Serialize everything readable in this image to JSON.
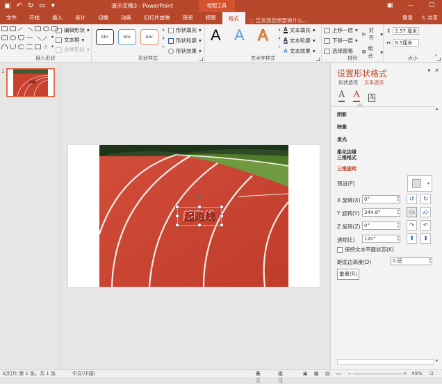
{
  "app": {
    "doc_title": "演示文稿3 - PowerPoint",
    "context_tool": "绘图工具",
    "accent": "#b7472a"
  },
  "quick_access": {
    "save_icon": "save-icon",
    "undo_icon": "undo-icon",
    "redo_icon": "redo-icon",
    "present_icon": "present-icon"
  },
  "tabs": [
    "文件",
    "开始",
    "插入",
    "设计",
    "切换",
    "动画",
    "幻灯片放映",
    "审阅",
    "视图",
    "格式"
  ],
  "active_tab": "格式",
  "tellme": "告诉我您想要做什么...",
  "login": "登录",
  "share": "共享",
  "ribbon": {
    "insert_shapes": {
      "label": "插入形状",
      "edit_shape": "编辑形状",
      "textbox": "文本框",
      "merge_shapes": "合并形状"
    },
    "shape_styles": {
      "label": "形状样式",
      "swatches": [
        "Abc",
        "Abc",
        "Abc"
      ],
      "fill": "形状填充",
      "outline": "形状轮廓",
      "effects": "形状效果"
    },
    "wordart_styles": {
      "label": "艺术字样式",
      "letters": [
        "A",
        "A",
        "A"
      ],
      "text_fill": "文本填充",
      "text_outline": "文本轮廓",
      "text_effects": "文本效果"
    },
    "arrange": {
      "label": "排列",
      "bring_forward": "上移一层",
      "send_backward": "下移一层",
      "selection_pane": "选择窗格",
      "align": "对齐",
      "group": "组合",
      "rotate": "旋转"
    },
    "size": {
      "label": "大小",
      "height": "2.57 厘米",
      "width": "8.5厘米"
    }
  },
  "thumbs": {
    "slide_number": "1"
  },
  "slide": {
    "wordart_text": "起跑线"
  },
  "pane": {
    "title": "设置形状格式",
    "tab_shape": "形状选项",
    "tab_text": "文本选项",
    "sections": [
      "阴影",
      "映像",
      "发光",
      "柔化边缘",
      "三维格式",
      "三维旋转"
    ],
    "preset_label": "预设(P)",
    "x_rotation_label": "X 旋转(X)",
    "x_rotation": "0°",
    "y_rotation_label": "Y 旋转(Y)",
    "y_rotation": "344.8°",
    "z_rotation_label": "Z 旋转(Z)",
    "z_rotation": "0°",
    "perspective_label": "透视(E)",
    "perspective": "120°",
    "keep_flat": "保持文本平面状态(K)",
    "distance_label": "距底边高度(D)",
    "distance": "0 磅",
    "reset": "重置(R)"
  },
  "status": {
    "slide_info": "幻灯片 第 1 张，共 1 张",
    "language": "中文(中国)",
    "notes": "备注",
    "comments": "批注",
    "zoom": "49%"
  }
}
